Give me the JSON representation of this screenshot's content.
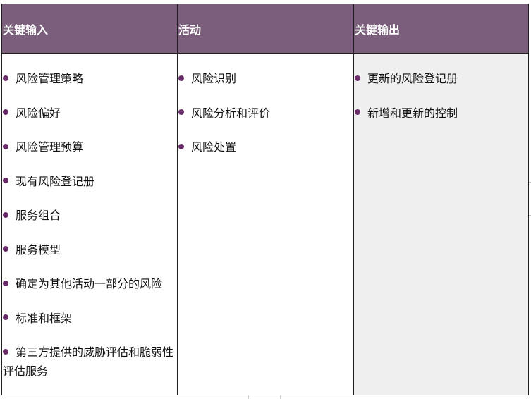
{
  "columns": [
    {
      "header": "关键输入",
      "items": [
        "风险管理策略",
        "风险偏好",
        "风险管理预算",
        "现有风险登记册",
        "服务组合",
        "服务模型",
        "确定为其他活动一部分的风险",
        "标准和框架",
        "第三方提供的威胁评估和脆弱性评估服务"
      ]
    },
    {
      "header": "活动",
      "items": [
        "风险识别",
        "风险分析和评价",
        "风险处置"
      ]
    },
    {
      "header": "关键输出",
      "items": [
        "更新的风险登记册",
        "新增和更新的控制"
      ]
    }
  ],
  "colors": {
    "header_bg": "#7b5e7b",
    "header_text": "#ffffff",
    "bullet": "#6b2d6a",
    "output_bg": "#efefef",
    "border": "#1f1f1f"
  },
  "icons": {
    "bullet": "bullet-icon"
  }
}
